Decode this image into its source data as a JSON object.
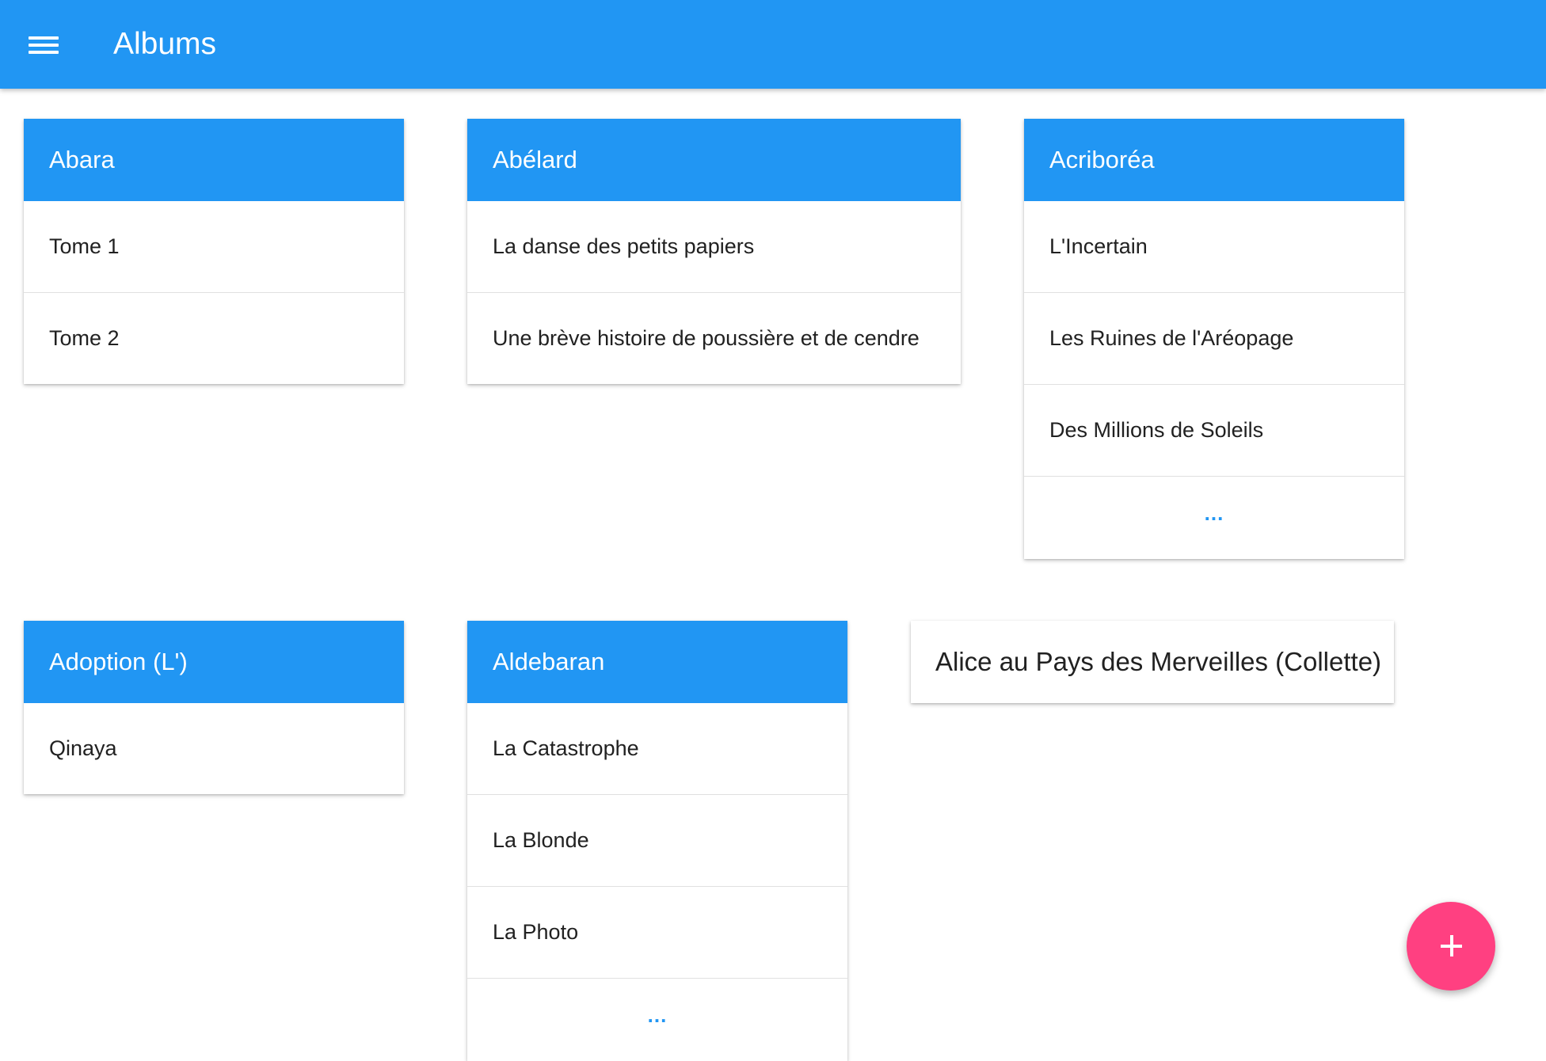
{
  "appbar": {
    "title": "Albums",
    "menu_icon": "hamburger-menu-icon"
  },
  "cards": {
    "abara": {
      "title": "Abara",
      "items": [
        "Tome 1",
        "Tome 2"
      ]
    },
    "abelard": {
      "title": "Abélard",
      "items": [
        "La danse des petits papiers",
        "Une brève histoire de poussière et de cendre"
      ]
    },
    "acriborea": {
      "title": "Acriboréa",
      "items": [
        "L'Incertain",
        "Les Ruines de l'Aréopage",
        "Des Millions de Soleils"
      ],
      "more": "..."
    },
    "adoption": {
      "title": "Adoption (L')",
      "items": [
        "Qinaya"
      ]
    },
    "aldebaran": {
      "title": "Aldebaran",
      "items": [
        "La Catastrophe",
        "La Blonde",
        "La Photo"
      ],
      "more": "..."
    },
    "alice": {
      "title": "Alice au Pays des Merveilles (Collette)"
    }
  },
  "fab": {
    "icon": "plus-icon"
  },
  "colors": {
    "primary": "#2196f3",
    "accent": "#ff4081",
    "text": "#212121",
    "divider": "#e0e0e0"
  }
}
